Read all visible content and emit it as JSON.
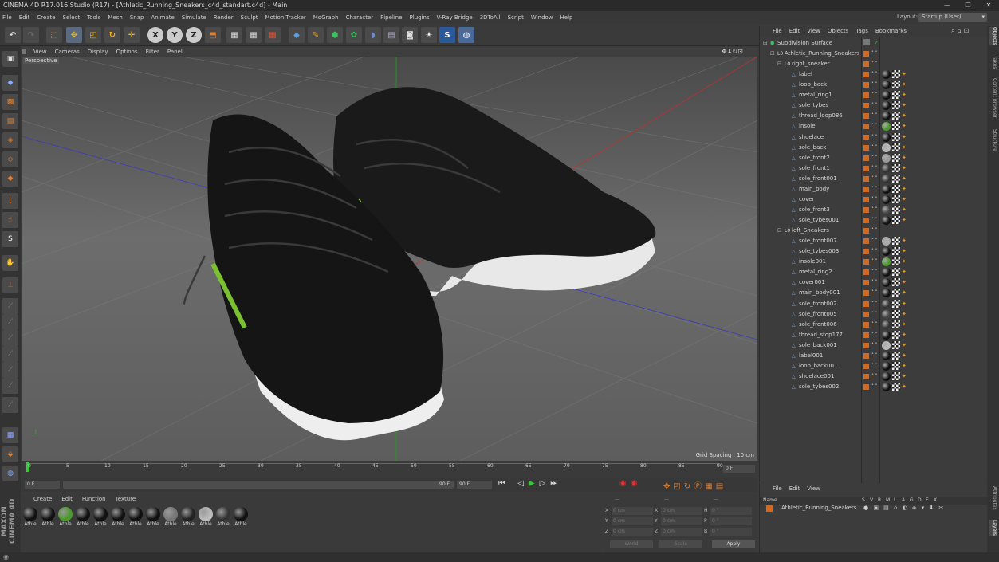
{
  "window": {
    "title": "CINEMA 4D R17.016 Studio (R17) - [Athletic_Running_Sneakers_c4d_standart.c4d] - Main",
    "controls": [
      "—",
      "❐",
      "✕"
    ]
  },
  "menu": [
    "File",
    "Edit",
    "Create",
    "Select",
    "Tools",
    "Mesh",
    "Snap",
    "Animate",
    "Simulate",
    "Render",
    "Sculpt",
    "Motion Tracker",
    "MoGraph",
    "Character",
    "Pipeline",
    "Plugins",
    "V-Ray Bridge",
    "3DToAll",
    "Script",
    "Window",
    "Help"
  ],
  "layout": {
    "label": "Layout:",
    "value": "Startup (User)"
  },
  "viewport": {
    "menu": [
      "View",
      "Cameras",
      "Display",
      "Options",
      "Filter",
      "Panel"
    ],
    "camera": "Perspective",
    "grid_spacing": "Grid Spacing : 10 cm"
  },
  "timeline": {
    "ticks": [
      "0",
      "5",
      "10",
      "15",
      "20",
      "25",
      "30",
      "35",
      "40",
      "45",
      "50",
      "55",
      "60",
      "65",
      "70",
      "75",
      "80",
      "85",
      "90"
    ],
    "end_field": "0 F"
  },
  "playbar": {
    "start": "0 F",
    "range_end": "90 F",
    "end": "90 F"
  },
  "materials": {
    "menu": [
      "Create",
      "Edit",
      "Function",
      "Texture"
    ],
    "items": [
      {
        "label": "Athle",
        "color": "#111"
      },
      {
        "label": "Athle",
        "color": "#111"
      },
      {
        "label": "Athle",
        "color": "#4a9a2a"
      },
      {
        "label": "Athle",
        "color": "#111"
      },
      {
        "label": "Athle",
        "color": "#111"
      },
      {
        "label": "Athle",
        "color": "#111"
      },
      {
        "label": "Athle",
        "color": "#111"
      },
      {
        "label": "Athle",
        "color": "#111"
      },
      {
        "label": "Athle",
        "color": "#777"
      },
      {
        "label": "Athle",
        "color": "#222"
      },
      {
        "label": "Athle",
        "color": "#bbb"
      },
      {
        "label": "Athle",
        "color": "#333"
      },
      {
        "label": "Athle",
        "color": "#111"
      }
    ]
  },
  "coords": {
    "header": [
      "—",
      "—",
      "—"
    ],
    "rows": [
      {
        "a": "X",
        "av": "0 cm",
        "b": "X",
        "bv": "0 cm",
        "c": "H",
        "cv": "0 °"
      },
      {
        "a": "Y",
        "av": "0 cm",
        "b": "Y",
        "bv": "0 cm",
        "c": "P",
        "cv": "0 °"
      },
      {
        "a": "Z",
        "av": "0 cm",
        "b": "Z",
        "bv": "0 cm",
        "c": "B",
        "cv": "0 °"
      }
    ],
    "world": "World",
    "scale": "Scale",
    "apply": "Apply"
  },
  "objects": {
    "menu": [
      "File",
      "Edit",
      "View",
      "Objects",
      "Tags",
      "Bookmarks"
    ],
    "rows": [
      {
        "name": "Subdivision Surface",
        "indent": 0,
        "type": "sub"
      },
      {
        "name": "Athletic_Running_Sneakers",
        "indent": 1,
        "type": "null"
      },
      {
        "name": "right_sneaker",
        "indent": 2,
        "type": "null"
      },
      {
        "name": "label",
        "indent": 3,
        "type": "mesh",
        "mat": "#111"
      },
      {
        "name": "loop_back",
        "indent": 3,
        "type": "mesh",
        "mat": "#111"
      },
      {
        "name": "metal_ring1",
        "indent": 3,
        "type": "mesh",
        "mat": "#111"
      },
      {
        "name": "sole_tybes",
        "indent": 3,
        "type": "mesh",
        "mat": "#111"
      },
      {
        "name": "thread_loop086",
        "indent": 3,
        "type": "mesh",
        "mat": "#111"
      },
      {
        "name": "insole",
        "indent": 3,
        "type": "mesh",
        "mat": "#4a9a2a"
      },
      {
        "name": "shoelace",
        "indent": 3,
        "type": "mesh",
        "mat": "#111"
      },
      {
        "name": "sole_back",
        "indent": 3,
        "type": "mesh",
        "mat": "#bbb"
      },
      {
        "name": "sole_front2",
        "indent": 3,
        "type": "mesh",
        "mat": "#999"
      },
      {
        "name": "sole_front1",
        "indent": 3,
        "type": "mesh",
        "mat": "#333"
      },
      {
        "name": "sole_front001",
        "indent": 3,
        "type": "mesh",
        "mat": "#333"
      },
      {
        "name": "main_body",
        "indent": 3,
        "type": "mesh",
        "mat": "#111"
      },
      {
        "name": "cover",
        "indent": 3,
        "type": "mesh",
        "mat": "#111"
      },
      {
        "name": "sole_front3",
        "indent": 3,
        "type": "mesh",
        "mat": "#444"
      },
      {
        "name": "sole_tybes001",
        "indent": 3,
        "type": "mesh",
        "mat": "#111"
      },
      {
        "name": "left_Sneakers",
        "indent": 2,
        "type": "null"
      },
      {
        "name": "sole_front007",
        "indent": 3,
        "type": "mesh",
        "mat": "#aaa"
      },
      {
        "name": "sole_tybes003",
        "indent": 3,
        "type": "mesh",
        "mat": "#111"
      },
      {
        "name": "insole001",
        "indent": 3,
        "type": "mesh",
        "mat": "#4a9a2a"
      },
      {
        "name": "metal_ring2",
        "indent": 3,
        "type": "mesh",
        "mat": "#111"
      },
      {
        "name": "cover001",
        "indent": 3,
        "type": "mesh",
        "mat": "#111"
      },
      {
        "name": "main_body001",
        "indent": 3,
        "type": "mesh",
        "mat": "#111"
      },
      {
        "name": "sole_front002",
        "indent": 3,
        "type": "mesh",
        "mat": "#333"
      },
      {
        "name": "sole_front005",
        "indent": 3,
        "type": "mesh",
        "mat": "#444"
      },
      {
        "name": "sole_front006",
        "indent": 3,
        "type": "mesh",
        "mat": "#333"
      },
      {
        "name": "thread_stop177",
        "indent": 3,
        "type": "mesh",
        "mat": "#111"
      },
      {
        "name": "sole_back001",
        "indent": 3,
        "type": "mesh",
        "mat": "#bbb"
      },
      {
        "name": "label001",
        "indent": 3,
        "type": "mesh",
        "mat": "#111"
      },
      {
        "name": "loop_back001",
        "indent": 3,
        "type": "mesh",
        "mat": "#111"
      },
      {
        "name": "shoelace001",
        "indent": 3,
        "type": "mesh",
        "mat": "#111"
      },
      {
        "name": "sole_tybes002",
        "indent": 3,
        "type": "mesh",
        "mat": "#111"
      }
    ]
  },
  "layers": {
    "menu": [
      "File",
      "Edit",
      "View"
    ],
    "columns": [
      "Name",
      "S",
      "V",
      "R",
      "M",
      "L",
      "A",
      "G",
      "D",
      "E",
      "X"
    ],
    "row": "Athletic_Running_Sneakers"
  },
  "side_tabs": [
    "Objects",
    "Takes",
    "Content Browser",
    "Structure",
    "Attributes",
    "Layers"
  ],
  "logo": "MAXON CINEMA 4D"
}
